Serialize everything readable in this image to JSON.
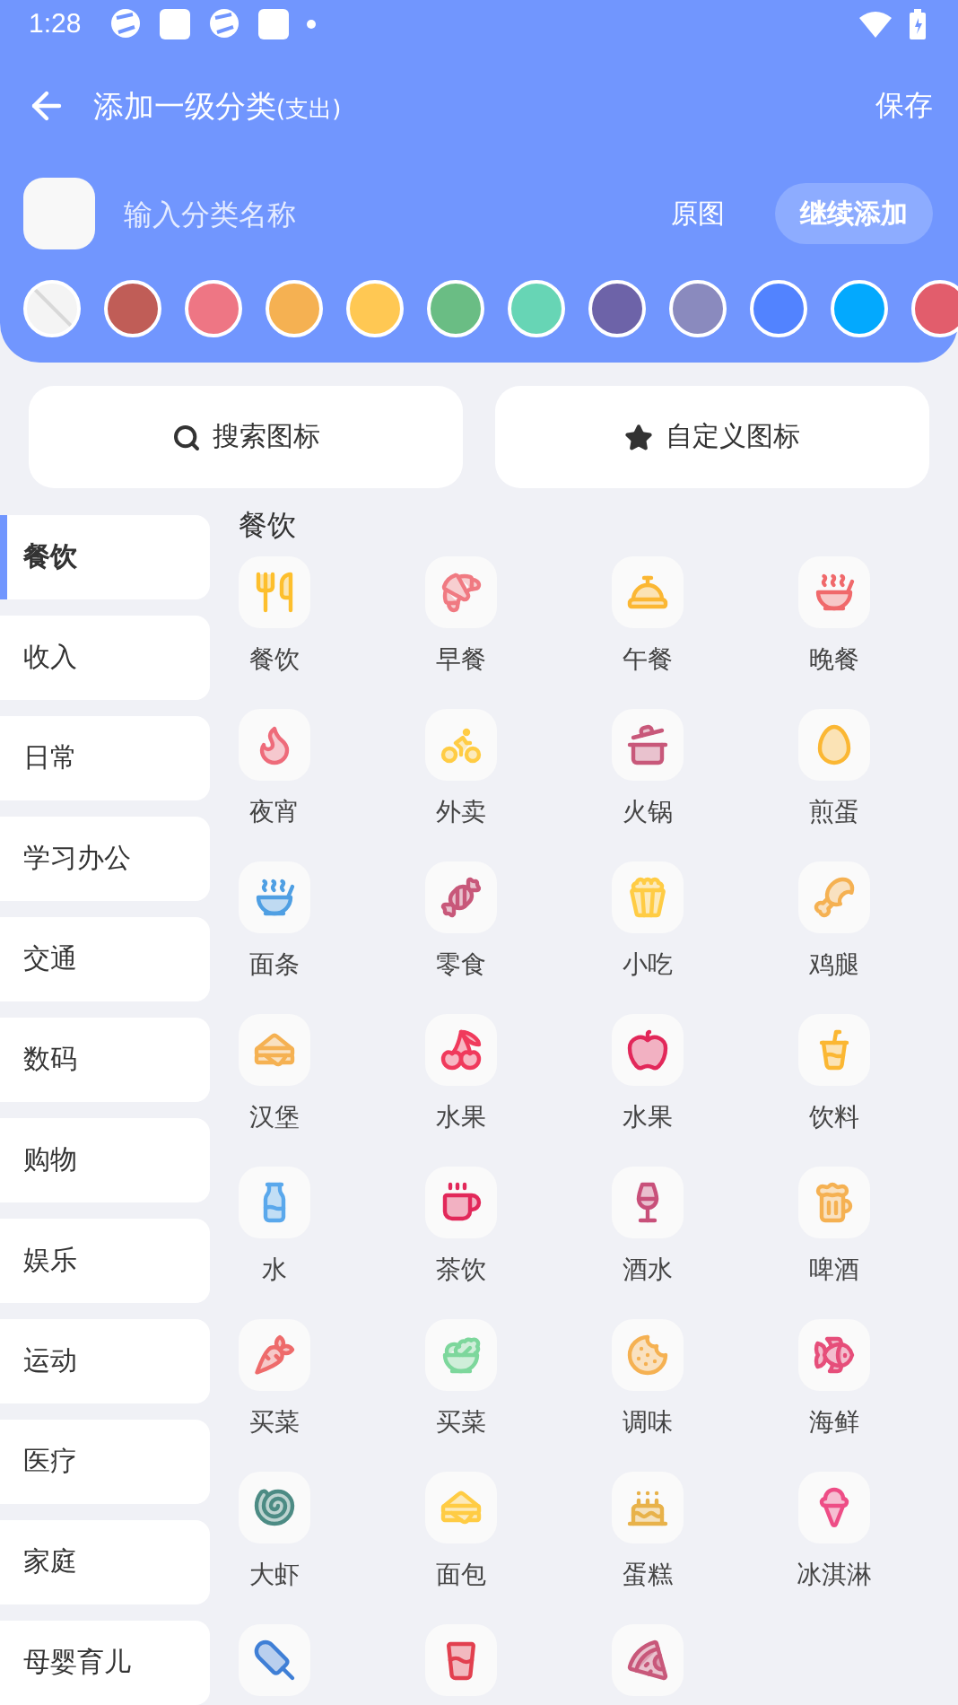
{
  "status_bar": {
    "time": "1:28"
  },
  "header": {
    "title": "添加一级分类",
    "title_suffix": "(支出)",
    "save": "保存"
  },
  "name_input": {
    "placeholder": "输入分类名称",
    "original": "原图",
    "continue": "继续添加"
  },
  "colors": [
    {
      "kind": "none"
    },
    {
      "kind": "swatch",
      "color": "#c05d57"
    },
    {
      "kind": "swatch",
      "color": "#ee7684"
    },
    {
      "kind": "swatch",
      "color": "#f5b152"
    },
    {
      "kind": "swatch",
      "color": "#ffc853"
    },
    {
      "kind": "swatch",
      "color": "#6abd84"
    },
    {
      "kind": "swatch",
      "color": "#67d5b5"
    },
    {
      "kind": "swatch",
      "color": "#6d63a8"
    },
    {
      "kind": "swatch",
      "color": "#8a8abe"
    },
    {
      "kind": "swatch",
      "color": "#5283ff"
    },
    {
      "kind": "swatch",
      "color": "#03a9fe"
    },
    {
      "kind": "swatch",
      "color": "#e25d6c"
    }
  ],
  "actions": [
    {
      "kind": "search",
      "label": "搜索图标"
    },
    {
      "kind": "star",
      "label": "自定义图标"
    }
  ],
  "sidebar": {
    "items": [
      {
        "label": "餐饮",
        "selected": true
      },
      {
        "label": "收入",
        "selected": false
      },
      {
        "label": "日常",
        "selected": false
      },
      {
        "label": "学习办公",
        "selected": false
      },
      {
        "label": "交通",
        "selected": false
      },
      {
        "label": "数码",
        "selected": false
      },
      {
        "label": "购物",
        "selected": false
      },
      {
        "label": "娱乐",
        "selected": false
      },
      {
        "label": "运动",
        "selected": false
      },
      {
        "label": "医疗",
        "selected": false
      },
      {
        "label": "家庭",
        "selected": false
      },
      {
        "label": "母婴育儿",
        "selected": false
      }
    ]
  },
  "section": {
    "title": "餐饮",
    "icons": [
      {
        "kind": "labeled",
        "label": "餐饮"
      },
      {
        "kind": "labeled",
        "label": "早餐"
      },
      {
        "kind": "labeled",
        "label": "午餐"
      },
      {
        "kind": "labeled",
        "label": "晚餐"
      },
      {
        "kind": "labeled",
        "label": "夜宵"
      },
      {
        "kind": "labeled",
        "label": "外卖"
      },
      {
        "kind": "labeled",
        "label": "火锅"
      },
      {
        "kind": "labeled",
        "label": "煎蛋"
      },
      {
        "kind": "labeled",
        "label": "面条"
      },
      {
        "kind": "labeled",
        "label": "零食"
      },
      {
        "kind": "labeled",
        "label": "小吃"
      },
      {
        "kind": "labeled",
        "label": "鸡腿"
      },
      {
        "kind": "labeled",
        "label": "汉堡"
      },
      {
        "kind": "labeled",
        "label": "水果"
      },
      {
        "kind": "labeled",
        "label": "水果"
      },
      {
        "kind": "labeled",
        "label": "饮料"
      },
      {
        "kind": "labeled",
        "label": "水"
      },
      {
        "kind": "labeled",
        "label": "茶饮"
      },
      {
        "kind": "labeled",
        "label": "酒水"
      },
      {
        "kind": "labeled",
        "label": "啤酒"
      },
      {
        "kind": "labeled",
        "label": "买菜"
      },
      {
        "kind": "labeled",
        "label": "买菜"
      },
      {
        "kind": "labeled",
        "label": "调味"
      },
      {
        "kind": "labeled",
        "label": "海鲜"
      },
      {
        "kind": "labeled",
        "label": "大虾"
      },
      {
        "kind": "labeled",
        "label": "面包"
      },
      {
        "kind": "labeled",
        "label": "蛋糕"
      },
      {
        "kind": "labeled",
        "label": "冰淇淋"
      },
      {
        "kind": "cut"
      },
      {
        "kind": "cut"
      },
      {
        "kind": "cut"
      }
    ]
  }
}
